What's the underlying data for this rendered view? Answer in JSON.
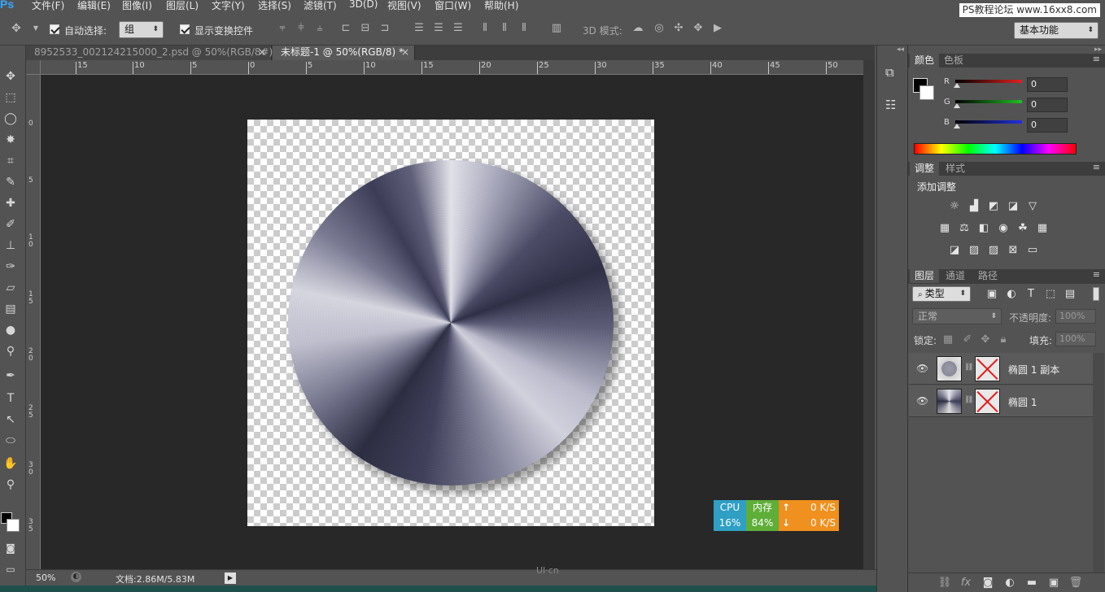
{
  "menubar": {
    "logo": "Ps",
    "items": [
      "文件(F)",
      "编辑(E)",
      "图像(I)",
      "图层(L)",
      "文字(Y)",
      "选择(S)",
      "滤镜(T)",
      "3D(D)",
      "视图(V)",
      "窗口(W)",
      "帮助(H)"
    ],
    "watermark": "PS教程论坛 www.16xx8.com"
  },
  "options": {
    "auto_select_label": "自动选择:",
    "auto_select_value": "组",
    "show_transform_label": "显示变换控件",
    "mode_3d_label": "3D 模式:",
    "workspace": "基本功能"
  },
  "tabs": [
    {
      "label": "8952533_002124215000_2.psd @ 50%(RGB/8#) *",
      "close": "×"
    },
    {
      "label": "未标题-1 @ 50%(RGB/8) *",
      "close": "×"
    }
  ],
  "ruler": {
    "top_ticks": [
      "15",
      "10",
      "5",
      "0",
      "5",
      "10",
      "15",
      "20",
      "25",
      "30",
      "35",
      "40",
      "45",
      "50"
    ],
    "left_ticks": [
      "0",
      "5",
      "10",
      "15",
      "20",
      "25",
      "30",
      "35"
    ]
  },
  "perf": {
    "cpu_label": "CPU",
    "cpu_value": "16%",
    "mem_label": "内存",
    "mem_value": "84%",
    "up_arrow": "↑",
    "down_arrow": "↓",
    "up_speed": "0 K/S",
    "down_speed": "0 K/S",
    "colors": {
      "cpu": "#2f9fc4",
      "mem": "#5fae38",
      "net": "#f0901e"
    }
  },
  "status": {
    "zoom": "50%",
    "doc_info": "文档:2.86M/5.83M",
    "logo_text": "UI·cn"
  },
  "color_panel": {
    "tabs": [
      "颜色",
      "色板"
    ],
    "channels": [
      {
        "label": "R",
        "value": "0",
        "color": "#e02020"
      },
      {
        "label": "G",
        "value": "0",
        "color": "#20c020"
      },
      {
        "label": "B",
        "value": "0",
        "color": "#2030e0"
      }
    ]
  },
  "adjust_panel": {
    "tabs": [
      "调整",
      "样式"
    ],
    "title": "添加调整"
  },
  "layers_panel": {
    "tabs": [
      "图层",
      "通道",
      "路径"
    ],
    "filter_label": "类型",
    "blend_mode": "正常",
    "opacity_label": "不透明度:",
    "opacity_value": "100%",
    "lock_label": "锁定:",
    "fill_label": "填充:",
    "fill_value": "100%",
    "layers": [
      {
        "name": "椭圆 1 副本"
      },
      {
        "name": "椭圆 1"
      }
    ]
  }
}
